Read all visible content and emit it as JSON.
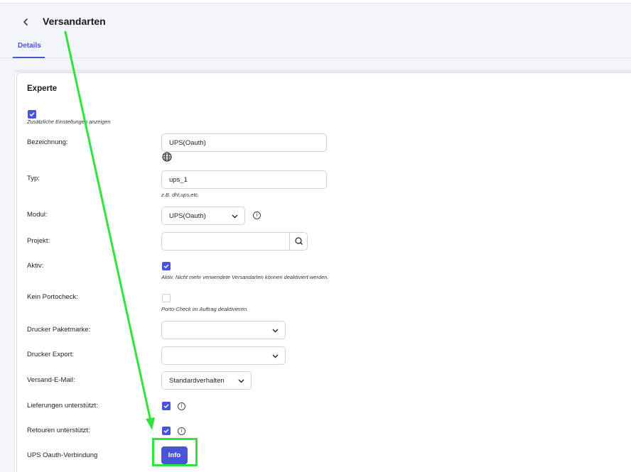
{
  "header": {
    "title": "Versandarten",
    "tab": "Details"
  },
  "section": {
    "title": "Experte",
    "show_more_label": "Zusätzliche Einstellungen anzeigen"
  },
  "form": {
    "bezeichnung": {
      "label": "Bezeichnung:",
      "value": "UPS(Oauth)"
    },
    "typ": {
      "label": "Typ:",
      "value": "ups_1",
      "hint": "z.B. dhl,ups,etc."
    },
    "modul": {
      "label": "Modul:",
      "value": "UPS(Oauth)"
    },
    "projekt": {
      "label": "Projekt:",
      "value": ""
    },
    "aktiv": {
      "label": "Aktiv:",
      "checked": true,
      "hint": "Aktiv. Nicht mehr verwendete Versandarten können deaktiviert werden."
    },
    "kein_portocheck": {
      "label": "Kein Portocheck:",
      "checked": false,
      "hint": "Porto-Check im Auftrag deaktivieren."
    },
    "drucker_paketmarke": {
      "label": "Drucker Paketmarke:",
      "value": ""
    },
    "drucker_export": {
      "label": "Drucker Export:",
      "value": ""
    },
    "versand_email": {
      "label": "Versand-E-Mail:",
      "value": "Standardverhalten"
    },
    "lieferungen": {
      "label": "Lieferungen unterstützt:",
      "checked": true
    },
    "retouren": {
      "label": "Retouren unterstützt:",
      "checked": true
    },
    "ups_oauth": {
      "label": "UPS Oauth-Verbindung",
      "button": "Info"
    }
  },
  "colors": {
    "accent": "#4a54d8",
    "annotation": "#31e43c"
  }
}
